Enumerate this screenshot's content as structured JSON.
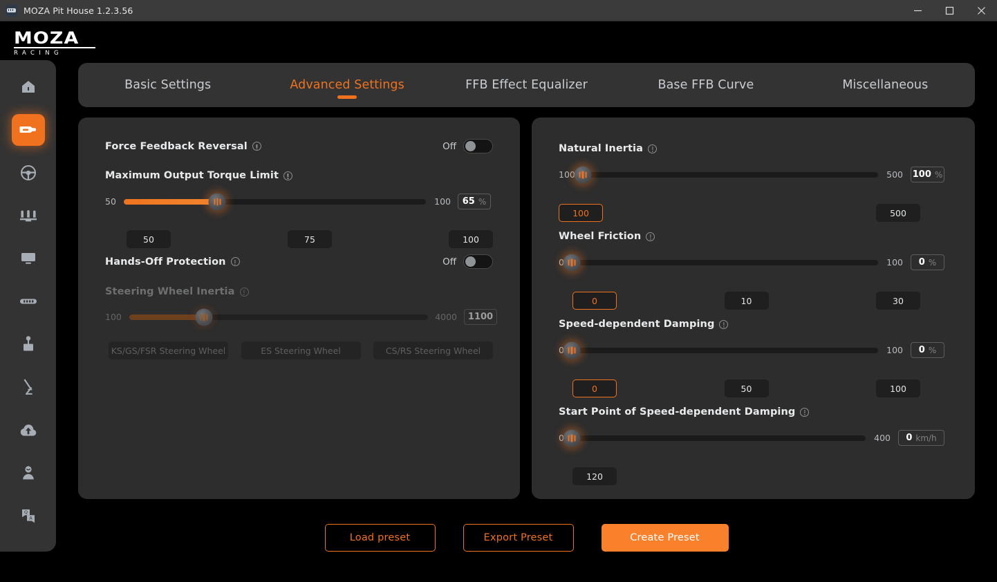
{
  "window": {
    "title": "MOZA Pit House 1.2.3.56",
    "app_icon": "wheelbase-icon",
    "controls": {
      "minimize": "minimize-icon",
      "maximize": "maximize-icon",
      "close": "close-icon"
    }
  },
  "brand": {
    "name": "MOZA",
    "tagline": "RACING"
  },
  "sidebar": {
    "items": [
      {
        "icon": "home-icon",
        "name": "home",
        "active": false
      },
      {
        "icon": "wheelbase-icon",
        "name": "wheelbase",
        "active": true
      },
      {
        "icon": "steering-wheel-icon",
        "name": "steering-wheel",
        "active": false
      },
      {
        "icon": "pedals-icon",
        "name": "pedals",
        "active": false
      },
      {
        "icon": "dashboard-icon",
        "name": "dashboard",
        "active": false
      },
      {
        "icon": "handbrake-icon",
        "name": "handbrake",
        "active": false
      },
      {
        "icon": "shifter-icon",
        "name": "shifter",
        "active": false
      },
      {
        "icon": "sequential-shifter-icon",
        "name": "sequential-shifter",
        "active": false
      },
      {
        "icon": "cloud-upload-icon",
        "name": "cloud",
        "active": false
      },
      {
        "icon": "user-icon",
        "name": "account",
        "active": false
      },
      {
        "icon": "qa-icon",
        "name": "support",
        "active": false
      }
    ]
  },
  "tabs": [
    {
      "label": "Basic Settings",
      "active": false
    },
    {
      "label": "Advanced Settings",
      "active": true
    },
    {
      "label": "FFB Effect Equalizer",
      "active": false
    },
    {
      "label": "Base FFB Curve",
      "active": false
    },
    {
      "label": "Miscellaneous",
      "active": false
    }
  ],
  "left_panel": {
    "force_feedback_reversal": {
      "title": "Force Feedback Reversal",
      "toggle_label": "Off",
      "enabled": false
    },
    "maximum_output_torque_limit": {
      "title": "Maximum Output Torque Limit",
      "min": "50",
      "max": "100",
      "value": "65",
      "unit": "%",
      "fill_percent": 31,
      "presets": [
        "50",
        "75",
        "100"
      ],
      "selected_preset": null
    },
    "hands_off_protection": {
      "title": "Hands-Off Protection",
      "toggle_label": "Off",
      "enabled": false
    },
    "steering_wheel_inertia": {
      "title": "Steering Wheel Inertia",
      "min": "100",
      "max": "4000",
      "value": "1100",
      "unit": "",
      "fill_percent": 25,
      "disabled": true,
      "presets": [
        "KS/GS/FSR Steering Wheel",
        "ES Steering Wheel",
        "CS/RS Steering Wheel"
      ]
    }
  },
  "right_panel": {
    "natural_inertia": {
      "title": "Natural Inertia",
      "min": "100",
      "max": "500",
      "value": "100",
      "unit": "%",
      "fill_percent": 0,
      "presets": [
        "100",
        "500"
      ],
      "selected_preset": "100"
    },
    "wheel_friction": {
      "title": "Wheel Friction",
      "min": "0",
      "max": "100",
      "value": "0",
      "unit": "%",
      "fill_percent": 0,
      "presets": [
        "0",
        "10",
        "30"
      ],
      "selected_preset": "0"
    },
    "speed_dependent_damping": {
      "title": "Speed-dependent Damping",
      "min": "0",
      "max": "100",
      "value": "0",
      "unit": "%",
      "fill_percent": 0,
      "presets": [
        "0",
        "50",
        "100"
      ],
      "selected_preset": "0"
    },
    "start_point_damping": {
      "title": "Start Point of Speed-dependent Damping",
      "min": "0",
      "max": "400",
      "value": "0",
      "unit": "km/h",
      "fill_percent": 0,
      "presets": [
        "120"
      ],
      "selected_preset": null
    }
  },
  "actions": {
    "load": "Load preset",
    "export": "Export Preset",
    "create": "Create Preset"
  },
  "colors": {
    "accent": "#f0721e",
    "panel": "#2d2d2d",
    "sidebar": "#333333",
    "background": "#000000",
    "titlebar": "#3b3b3b"
  }
}
